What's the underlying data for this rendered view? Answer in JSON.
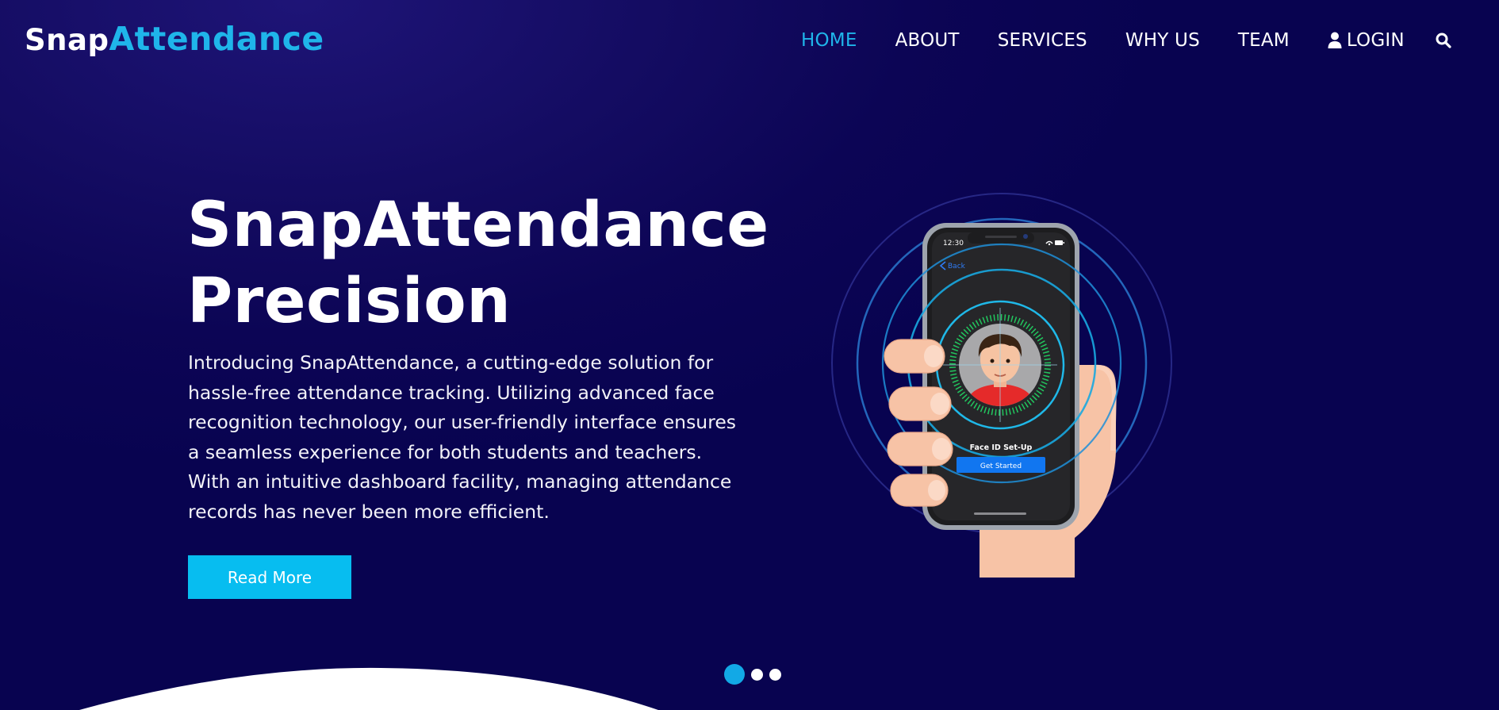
{
  "brand": {
    "part1": "Snap",
    "part2": "Attendance"
  },
  "nav": {
    "home": "HOME",
    "about": "ABOUT",
    "services": "SERVICES",
    "why_us": "WHY US",
    "team": "TEAM",
    "login": "LOGIN"
  },
  "hero": {
    "title_line1": "SnapAttendance",
    "title_line2": "Precision",
    "description": "Introducing SnapAttendance, a cutting-edge solution for hassle-free attendance tracking. Utilizing advanced face recognition technology, our user-friendly interface ensures a seamless experience for both students and teachers. With an intuitive dashboard facility, managing attendance records has never been more efficient.",
    "button_label": "Read More"
  },
  "phone": {
    "time": "12:30",
    "back_label": "Back",
    "setup_label": "Face ID Set-Up",
    "cta_label": "Get Started"
  },
  "carousel": {
    "slides": 3,
    "active": 1
  },
  "colors": {
    "accent": "#1fb5ea",
    "button": "#07bdf0",
    "background": "#0c0555"
  },
  "icons": [
    "user-icon",
    "search-icon",
    "wifi-icon",
    "battery-icon"
  ]
}
